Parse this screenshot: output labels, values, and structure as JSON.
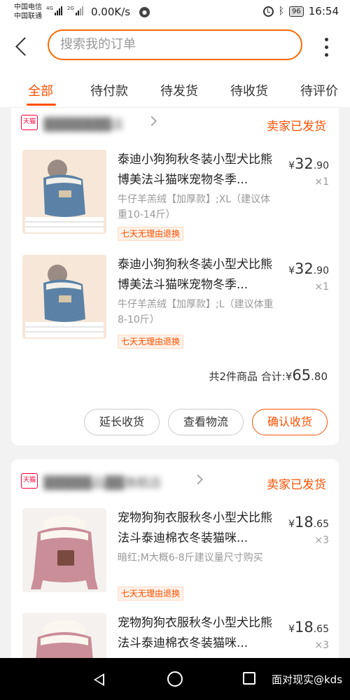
{
  "status_bar": {
    "carrier1": "中国电信",
    "carrier1_tag": "4G",
    "carrier2": "中国联通",
    "carrier2_tag": "2G",
    "speed": "0.00K/s",
    "battery": "96",
    "time": "16:54"
  },
  "header": {
    "search_placeholder": "搜索我的订单"
  },
  "tabs": [
    "全部",
    "待付款",
    "待发货",
    "待收货",
    "待评价"
  ],
  "orders": [
    {
      "store_badge": "天猫",
      "store_name": "▓▓▓▓▓▓▓店",
      "status": "卖家已发货",
      "items": [
        {
          "title": "泰迪小狗狗秋冬装小型犬比熊博美法斗猫咪宠物冬季...",
          "sku": "牛仔羊羔绒【加厚款】;XL（建议体重10-14斤）",
          "badge": "七天无理由退换",
          "price_symbol": "¥",
          "price_int": "32",
          "price_dec": ".90",
          "qty": "×1"
        },
        {
          "title": "泰迪小狗狗秋冬装小型犬比熊博美法斗猫咪宠物冬季...",
          "sku": "牛仔羊羔绒【加厚款】;L（建议体重8-10斤）",
          "badge": "七天无理由退换",
          "price_symbol": "¥",
          "price_int": "32",
          "price_dec": ".90",
          "qty": "×1"
        }
      ],
      "summary": {
        "count_text": "共2件商品",
        "total_label": "合计:",
        "total_symbol": "¥",
        "total_int": "65",
        "total_dec": ".80"
      },
      "buttons": [
        "延长收货",
        "查看物流",
        "确认收货"
      ]
    },
    {
      "store_badge": "天猫",
      "store_name": "▓▓▓▓▓品▓▓旗舰店",
      "status": "卖家已发货",
      "items": [
        {
          "title": "宠物狗狗衣服秋冬小型犬比熊法斗泰迪棉衣冬装猫咪...",
          "sku": "暗红;M大概6-8斤建议量尺寸购买",
          "badge": "七天无理由退换",
          "price_symbol": "¥",
          "price_int": "18",
          "price_dec": ".65",
          "qty": "×3"
        },
        {
          "title": "宠物狗狗衣服秋冬小型犬比熊法斗泰迪棉衣冬装猫咪...",
          "price_symbol": "¥",
          "price_int": "18",
          "price_dec": ".65",
          "qty": "×3"
        }
      ]
    }
  ],
  "watermark": "面对现实@kds",
  "colors": {
    "accent": "#ff5000",
    "search_border": "#ff6a00",
    "tmall_red": "#ff0036"
  }
}
